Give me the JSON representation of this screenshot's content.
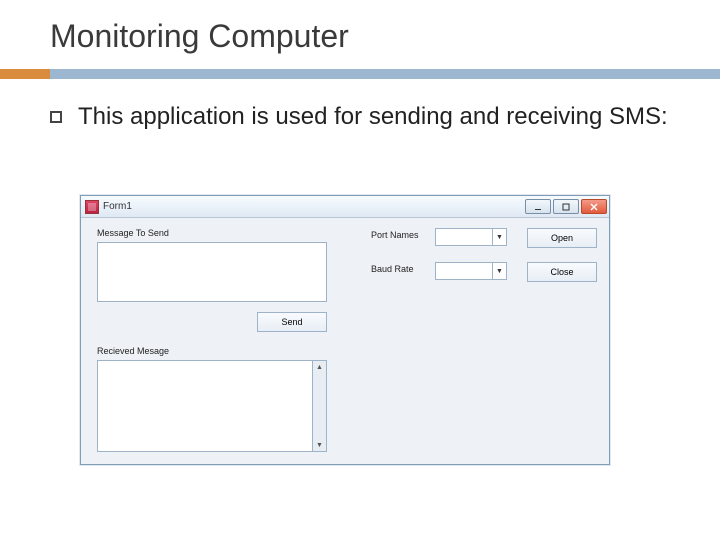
{
  "slide": {
    "title": "Monitoring Computer",
    "bullet_text": "This application is used for sending and receiving SMS:"
  },
  "colors": {
    "accent_orange": "#d98b3e",
    "accent_blue": "#9db7d1"
  },
  "app": {
    "window_title": "Form1",
    "labels": {
      "message_to_send": "Message To Send",
      "received_message": "Recieved Mesage",
      "port_names": "Port Names",
      "baud_rate": "Baud Rate"
    },
    "buttons": {
      "send": "Send",
      "open": "Open",
      "close": "Close"
    },
    "fields": {
      "message_to_send_value": "",
      "received_message_value": "",
      "port_names_value": "",
      "baud_rate_value": ""
    }
  }
}
